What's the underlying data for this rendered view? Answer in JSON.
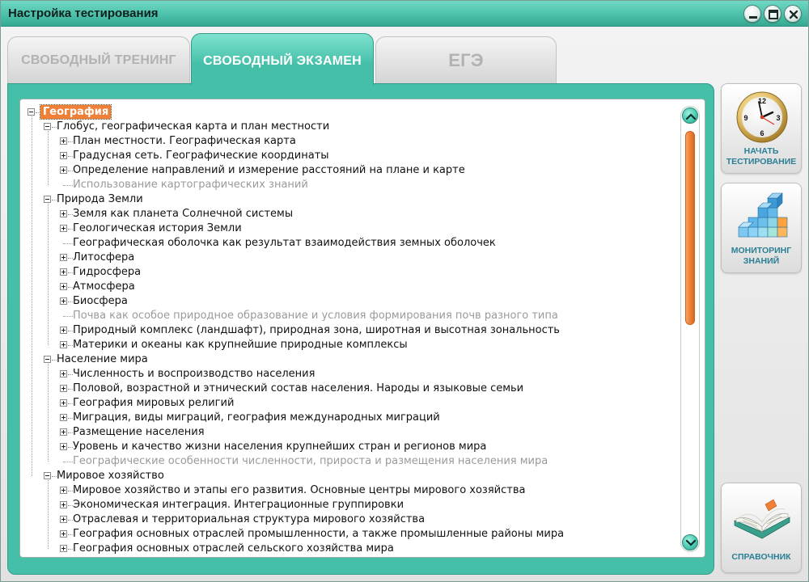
{
  "window": {
    "title": "Настройка тестирования"
  },
  "tabs": [
    {
      "label": "СВОБОДНЫЙ ТРЕНИНГ",
      "active": false
    },
    {
      "label": "СВОБОДНЫЙ ЭКЗАМЕН",
      "active": true
    },
    {
      "label": "ЕГЭ",
      "active": false
    }
  ],
  "tree": [
    {
      "level": 0,
      "label": "География",
      "toggle": "minus",
      "selected": true
    },
    {
      "level": 1,
      "label": "Глобус, географическая карта и план местности",
      "toggle": "minus"
    },
    {
      "level": 2,
      "label": "План местности. Географическая карта",
      "toggle": "plus"
    },
    {
      "level": 2,
      "label": "Градусная сеть. Географические координаты",
      "toggle": "plus"
    },
    {
      "level": 2,
      "label": "Определение направлений и измерение расстояний на плане и карте",
      "toggle": "plus"
    },
    {
      "level": 2,
      "label": "Использование картографических знаний",
      "toggle": "none",
      "disabled": true
    },
    {
      "level": 1,
      "label": "Природа Земли",
      "toggle": "minus"
    },
    {
      "level": 2,
      "label": "Земля как планета Солнечной системы",
      "toggle": "plus"
    },
    {
      "level": 2,
      "label": "Геологическая история Земли",
      "toggle": "plus"
    },
    {
      "level": 2,
      "label": "Географическая оболочка как результат взаимодействия земных оболочек",
      "toggle": "none"
    },
    {
      "level": 2,
      "label": "Литосфера",
      "toggle": "plus"
    },
    {
      "level": 2,
      "label": "Гидросфера",
      "toggle": "plus"
    },
    {
      "level": 2,
      "label": "Атмосфера",
      "toggle": "plus"
    },
    {
      "level": 2,
      "label": "Биосфера",
      "toggle": "plus"
    },
    {
      "level": 2,
      "label": "Почва как особое природное образование и условия формирования почв разного типа",
      "toggle": "none",
      "disabled": true
    },
    {
      "level": 2,
      "label": "Природный комплекс (ландшафт), природная зона, широтная и высотная зональность",
      "toggle": "plus"
    },
    {
      "level": 2,
      "label": "Материки и океаны как крупнейшие природные комплексы",
      "toggle": "plus"
    },
    {
      "level": 1,
      "label": "Население мира",
      "toggle": "minus"
    },
    {
      "level": 2,
      "label": "Численность и воспроизводство населения",
      "toggle": "plus"
    },
    {
      "level": 2,
      "label": "Половой, возрастной и этнический состав населения. Народы и языковые семьи",
      "toggle": "plus"
    },
    {
      "level": 2,
      "label": "География мировых религий",
      "toggle": "plus"
    },
    {
      "level": 2,
      "label": "Миграция, виды миграций, география международных миграций",
      "toggle": "plus"
    },
    {
      "level": 2,
      "label": "Размещение населения",
      "toggle": "plus"
    },
    {
      "level": 2,
      "label": "Уровень и качество жизни населения крупнейших стран и регионов мира",
      "toggle": "plus"
    },
    {
      "level": 2,
      "label": "Географические особенности численности, прироста и размещения населения мира",
      "toggle": "none",
      "disabled": true
    },
    {
      "level": 1,
      "label": "Мировое хозяйство",
      "toggle": "minus"
    },
    {
      "level": 2,
      "label": "Мировое хозяйство и этапы его развития. Основные центры мирового хозяйства",
      "toggle": "plus"
    },
    {
      "level": 2,
      "label": "Экономическая интеграция. Интеграционные группировки",
      "toggle": "plus"
    },
    {
      "level": 2,
      "label": "Отраслевая и территориальная структура мирового хозяйства",
      "toggle": "plus"
    },
    {
      "level": 2,
      "label": "География основных отраслей промышленности, а также промышленные районы мира",
      "toggle": "plus"
    },
    {
      "level": 2,
      "label": "География основных отраслей сельского хозяйства мира",
      "toggle": "plus"
    }
  ],
  "scroll": {
    "position": 0.0
  },
  "sidebar": {
    "start": {
      "line1": "НАЧАТЬ",
      "line2": "ТЕСТИРОВАНИЕ",
      "icon": "clock-icon"
    },
    "monitor": {
      "line1": "МОНИТОРИНГ",
      "line2": "ЗНАНИЙ",
      "icon": "cubes-chart-icon"
    },
    "reference": {
      "line1": "СПРАВОЧНИК",
      "icon": "open-book-icon"
    }
  },
  "colors": {
    "accent": "#45bfa8",
    "selection": "#f07f37",
    "caption": "#2a7f94"
  }
}
